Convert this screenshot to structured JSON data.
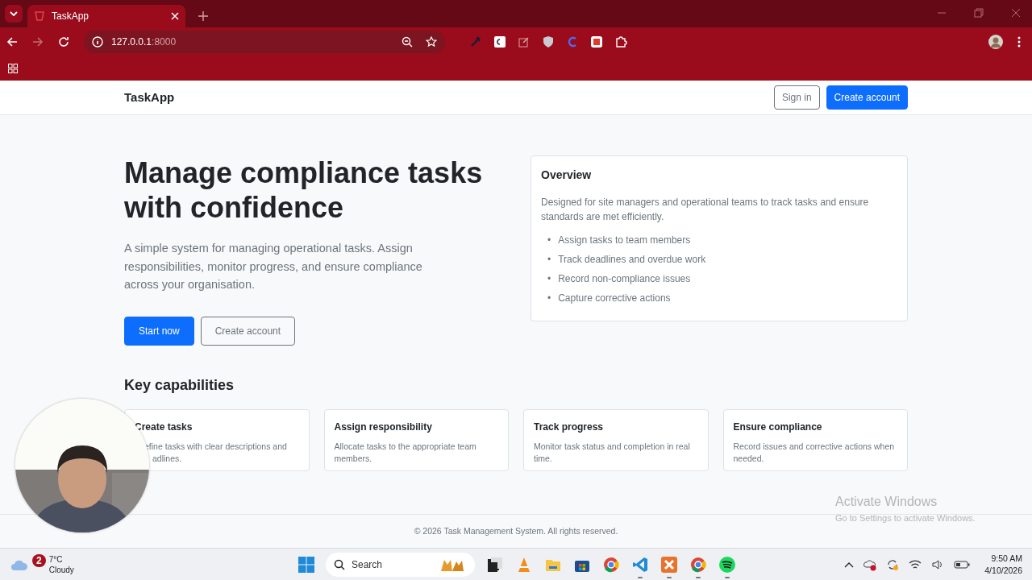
{
  "browser": {
    "tab_title": "TaskApp",
    "url_host": "127.0.0.1",
    "url_port": ":8000"
  },
  "navbar": {
    "brand": "TaskApp",
    "buttons": [
      {
        "label": "Sign in",
        "kind": "outline"
      },
      {
        "label": "Create account",
        "kind": "primary"
      }
    ]
  },
  "hero": {
    "title": "Manage compliance tasks with confidence",
    "lead": "A simple system for managing operational tasks. Assign responsibilities, monitor progress, and ensure compliance across your organisation.",
    "buttons": [
      {
        "label": "Start now",
        "kind": "primary"
      },
      {
        "label": "Create account",
        "kind": "outline"
      }
    ]
  },
  "overview": {
    "title": "Overview",
    "text": "Designed for site managers and operational teams to track tasks and ensure standards are met efficiently.",
    "items": [
      {
        "bullet": "•",
        "text": "Assign tasks to team members"
      },
      {
        "bullet": "•",
        "text": "Track deadlines and overdue work"
      },
      {
        "bullet": "•",
        "text": "Record non-compliance issues"
      },
      {
        "bullet": "•",
        "text": "Capture corrective actions"
      }
    ]
  },
  "capabilities": {
    "title": "Key capabilities",
    "cards": [
      {
        "title": "Create tasks",
        "text": "efine tasks with clear descriptions and adlines.",
        "covered": true
      },
      {
        "title": "Assign responsibility",
        "text": "Allocate tasks to the appropriate team members.",
        "covered": false
      },
      {
        "title": "Track progress",
        "text": "Monitor task status and completion in real time.",
        "covered": false
      },
      {
        "title": "Ensure compliance",
        "text": "Record issues and corrective actions when needed.",
        "covered": false
      }
    ]
  },
  "footer": "© 2026 Task Management System. All rights reserved.",
  "watermark": {
    "title": "Activate Windows",
    "subtitle": "Go to Settings to activate Windows."
  },
  "taskbar": {
    "weather": {
      "badge": "2",
      "temp": "7°C",
      "condition": "Cloudy"
    },
    "search": {
      "placeholder": "Search"
    },
    "apps": [
      {
        "kind": "files-dark",
        "running": false
      },
      {
        "kind": "cone",
        "running": false
      },
      {
        "kind": "folder",
        "running": false
      },
      {
        "kind": "store",
        "running": false
      },
      {
        "kind": "browser",
        "running": false
      },
      {
        "kind": "code",
        "running": true
      },
      {
        "kind": "server",
        "running": true
      },
      {
        "kind": "browser",
        "running": true
      },
      {
        "kind": "music",
        "running": true
      }
    ],
    "time": "9:50 AM",
    "date": "4/10/2026"
  }
}
